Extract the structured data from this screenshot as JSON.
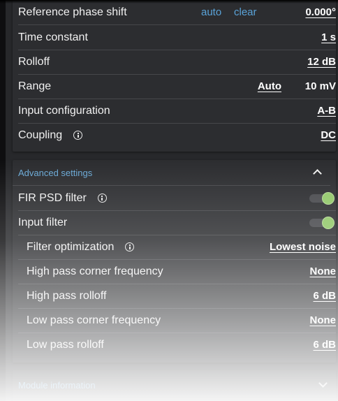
{
  "main": {
    "reference_phase": {
      "label": "Reference phase shift",
      "auto": "auto",
      "clear": "clear",
      "value": "0.000°"
    },
    "time_constant": {
      "label": "Time constant",
      "value": "1 s"
    },
    "rolloff": {
      "label": "Rolloff",
      "value": "12 dB"
    },
    "range": {
      "label": "Range",
      "mode": "Auto",
      "value": "10 mV"
    },
    "input_configuration": {
      "label": "Input configuration",
      "value": "A-B"
    },
    "coupling": {
      "label": "Coupling",
      "value": "DC"
    }
  },
  "advanced": {
    "title": "Advanced settings",
    "fir_psd_filter": {
      "label": "FIR PSD filter",
      "enabled": true
    },
    "input_filter": {
      "label": "Input filter",
      "enabled": true
    },
    "filter_optimization": {
      "label": "Filter optimization",
      "value": "Lowest noise"
    },
    "high_pass_corner": {
      "label": "High pass corner frequency",
      "value": "None"
    },
    "high_pass_rolloff": {
      "label": "High pass rolloff",
      "value": "6 dB"
    },
    "low_pass_corner": {
      "label": "Low pass corner frequency",
      "value": "None"
    },
    "low_pass_rolloff": {
      "label": "Low pass rolloff",
      "value": "6 dB"
    }
  },
  "module_information": {
    "title": "Module information"
  },
  "colors": {
    "accent": "#6aa9d6",
    "toggle_on": "#92c86a",
    "card": "#2c2d30",
    "background": "#27282b"
  }
}
